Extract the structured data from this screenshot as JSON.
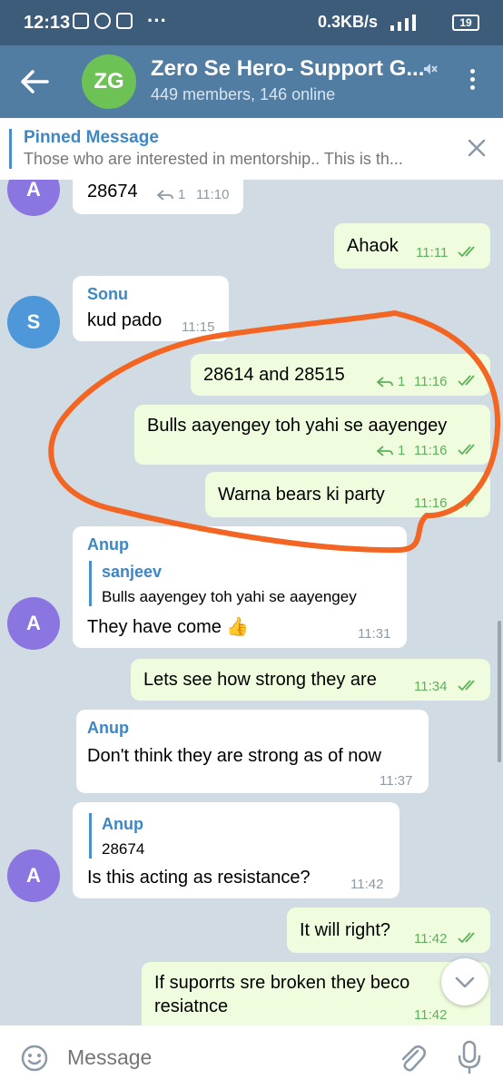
{
  "status_bar": {
    "time": "12:13",
    "net_speed": "0.3KB/s",
    "battery": "19"
  },
  "header": {
    "avatar_initials": "ZG",
    "title": "Zero Se Hero- Support G...",
    "subtitle": "449 members, 146 online"
  },
  "pinned": {
    "label": "Pinned Message",
    "text": "Those  who are interested in mentorship.. This is th..."
  },
  "messages": [
    {
      "type": "in",
      "text": "28674",
      "reply_count": "1",
      "time": "11:10"
    },
    {
      "type": "out",
      "text": "Ahaok",
      "time": "11:11"
    },
    {
      "type": "in",
      "sender": "Sonu",
      "avatar": "S",
      "text": "kud pado",
      "time": "11:15"
    },
    {
      "type": "out",
      "text": "28614 and 28515",
      "reply_count": "1",
      "time": "11:16"
    },
    {
      "type": "out",
      "text": "Bulls aayengey toh yahi se aayengey",
      "reply_count": "1",
      "time": "11:16"
    },
    {
      "type": "out",
      "text": "Warna bears ki party",
      "time": "11:16"
    },
    {
      "type": "in",
      "sender": "Anup",
      "avatar": "A",
      "reply_name": "sanjeev",
      "reply_text": "Bulls aayengey toh yahi se aayengey",
      "text": "They have come 👍",
      "time": "11:31"
    },
    {
      "type": "out",
      "text": "Lets see how strong they are",
      "time": "11:34"
    },
    {
      "type": "in",
      "sender": "Anup",
      "text": "Don't think they are strong as of now",
      "time": "11:37"
    },
    {
      "type": "in",
      "avatar": "A",
      "reply_name": "Anup",
      "reply_text": "28674",
      "text": "Is this acting as resistance?",
      "time": "11:42"
    },
    {
      "type": "out",
      "text": "It will right?",
      "time": "11:42"
    },
    {
      "type": "out",
      "text_line1": "If suporrts sre broken they beco",
      "text_line2": "resiatnce",
      "time": "11:42"
    }
  ],
  "avatars": {
    "first": "A",
    "anup": "A"
  },
  "input": {
    "placeholder": "Message"
  },
  "colors": {
    "header": "#527da3",
    "status_bar": "#3d5c7a",
    "outgoing_bubble": "#effdde",
    "incoming_bubble": "#ffffff",
    "annotation": "#f26522"
  },
  "icons": [
    "back-arrow-icon",
    "mute-icon",
    "more-vert-icon",
    "close-icon",
    "reply-count-icon",
    "double-check-icon",
    "emoji-icon",
    "attach-icon",
    "mic-icon",
    "chevron-down-icon"
  ]
}
